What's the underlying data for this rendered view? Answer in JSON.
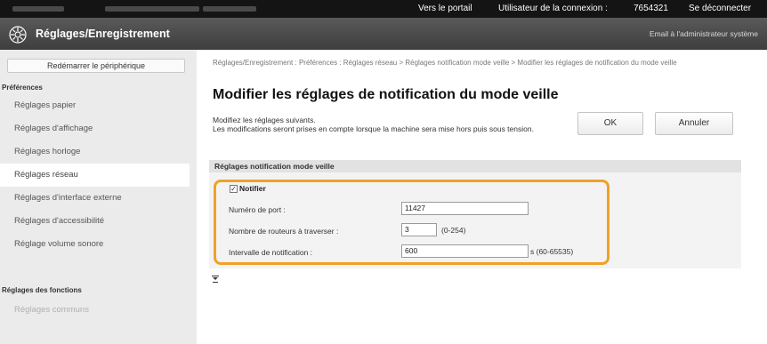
{
  "topbar": {
    "portal_link": "Vers le portail",
    "login_user_label": "Utilisateur de la connexion :",
    "login_user_id": "7654321",
    "logout_link": "Se déconnecter"
  },
  "header": {
    "app_title": "Réglages/Enregistrement",
    "admin_mail_link": "Email à l'administrateur système",
    "logo_icon": "gear-settings-icon"
  },
  "sidebar": {
    "restart_button": "Redémarrer le périphérique",
    "section_preferences": "Préférences",
    "items": [
      {
        "label": "Réglages papier"
      },
      {
        "label": "Réglages d'affichage"
      },
      {
        "label": "Réglages horloge"
      },
      {
        "label": "Réglages réseau"
      },
      {
        "label": "Réglages d'interface externe"
      },
      {
        "label": "Réglages d'accessibilité"
      },
      {
        "label": "Réglage volume sonore"
      }
    ],
    "active_item": "Réglages réseau",
    "section_functions": "Réglages des fonctions",
    "functions_items": [
      {
        "label": "Réglages communs"
      }
    ]
  },
  "main": {
    "breadcrumb": "Réglages/Enregistrement : Préférences : Réglages réseau > Réglages notification mode veille > Modifier les réglages de notification du mode veille",
    "title": "Modifier les réglages de notification du mode veille",
    "description_line1": "Modifiez les réglages suivants.",
    "description_line2": "Les modifications seront prises en compte lorsque la machine sera mise hors puis sous tension.",
    "ok_button": "OK",
    "cancel_button": "Annuler",
    "section_title": "Réglages notification mode veille",
    "notify_checkbox": {
      "label": "Notifier",
      "checked": true
    },
    "fields": {
      "port": {
        "label": "Numéro de port :",
        "value": "11427"
      },
      "routers": {
        "label": "Nombre de routeurs à traverser :",
        "value": "3",
        "hint": "(0-254)"
      },
      "interval": {
        "label": "Intervalle de notification :",
        "value": "600",
        "hint": "s (60-65535)"
      }
    }
  },
  "colors": {
    "highlight": "#f0a128",
    "header_bg": "#4a4a4a",
    "topbar_bg": "#141414"
  }
}
